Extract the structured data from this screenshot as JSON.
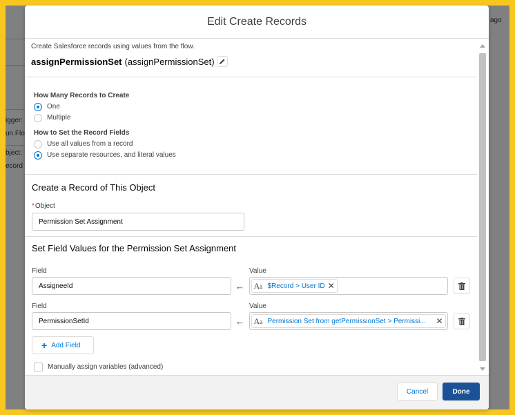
{
  "background": {
    "texts": [
      "ago",
      "igger:",
      "un Flov",
      "bject:",
      "ecord C"
    ]
  },
  "modal": {
    "title": "Edit Create Records",
    "description": "Create Salesforce records using values from the flow.",
    "api_name": "assignPermissionSet",
    "api_name_paren": "(assignPermissionSet)",
    "how_many": {
      "label": "How Many Records to Create",
      "options": [
        "One",
        "Multiple"
      ],
      "selected": "One"
    },
    "how_set": {
      "label": "How to Set the Record Fields",
      "options": [
        "Use all values from a record",
        "Use separate resources, and literal values"
      ],
      "selected": "Use separate resources, and literal values"
    },
    "object_section": {
      "title": "Create a Record of This Object",
      "required_mark": "*",
      "object_label": "Object",
      "object_value": "Permission Set Assignment"
    },
    "field_values": {
      "title": "Set Field Values for the Permission Set Assignment",
      "field_label": "Field",
      "value_label": "Value",
      "rows": [
        {
          "field": "AssigneeId",
          "value": "$Record > User ID"
        },
        {
          "field": "PermissionSetId",
          "value": "Permission Set from getPermissionSet > Permissi..."
        }
      ],
      "add_field_label": "Add Field",
      "manual_assign_label": "Manually assign variables (advanced)"
    },
    "footer": {
      "cancel_label": "Cancel",
      "done_label": "Done"
    }
  },
  "colors": {
    "frame": "#f7c71e",
    "accent": "#0176d3",
    "done_button": "#1b5297"
  }
}
